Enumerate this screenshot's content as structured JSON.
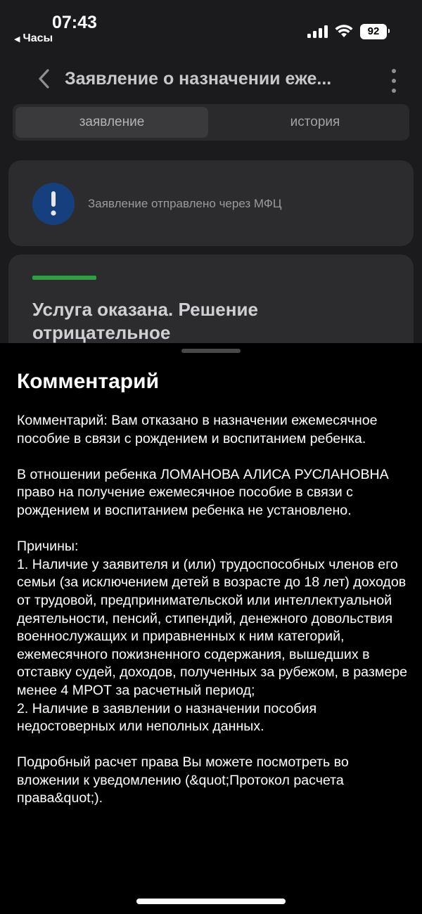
{
  "status_bar": {
    "time": "07:43",
    "back_app": "Часы",
    "battery": "92"
  },
  "header": {
    "title": "Заявление о назначении еже..."
  },
  "tabs": [
    {
      "label": "заявление",
      "active": true
    },
    {
      "label": "история",
      "active": false
    }
  ],
  "notice": {
    "text": "Заявление отправлено через МФЦ",
    "icon_color": "#15407d"
  },
  "status_card": {
    "title": "Услуга оказана. Решение отрицательное",
    "accent_color": "#2ea043"
  },
  "sheet": {
    "title": "Комментарий",
    "paragraphs": [
      "Комментарий: Вам отказано в назначении ежемесячное пособие в связи с рождением и воспитанием ребенка.",
      "В отношении ребенка ЛОМАНОВА АЛИСА РУСЛАНОВНА право на получение ежемесячное пособие в связи с рождением и воспитанием ребенка не установлено.",
      "Причины:\n1. Наличие у заявителя и (или) трудоспособных членов его семьи (за исключением детей в возрасте до 18 лет) доходов от трудовой, предпринимательской или интеллектуальной деятельности, пенсий, стипендий, денежного довольствия военнослужащих и приравненных к ним категорий, ежемесячного пожизненного содержания, вышедших в отставку судей, доходов, полученных за рубежом, в размере менее 4 МРОТ за расчетный период;\n2. Наличие в заявлении о назначении пособия недостоверных или неполных данных.",
      "Подробный расчет права Вы можете посмотреть во вложении к уведомлению (&quot;Протокол расчета права&quot;)."
    ]
  }
}
